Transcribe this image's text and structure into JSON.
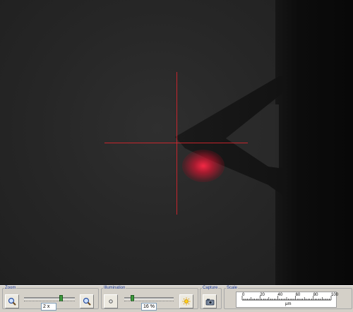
{
  "controls": {
    "zoom": {
      "legend": "Zoom",
      "value_text": "2 x",
      "slider_level_pct": 72
    },
    "illumination": {
      "legend": "Illumination",
      "value_text": "16 %",
      "slider_level_pct": 16
    },
    "capture": {
      "legend": "Capture"
    },
    "scale": {
      "legend": "Scale",
      "ticks": [
        "0",
        "20",
        "40",
        "60",
        "80",
        "100"
      ],
      "unit": "µm"
    }
  },
  "icons": {
    "zoom_out": "zoom-out-icon",
    "zoom_in": "zoom-in-icon",
    "dim": "light-dim-icon",
    "bright": "light-bright-icon",
    "capture": "camera-icon"
  },
  "colors": {
    "crosshair": "#e0262e",
    "laser": "#ff2846",
    "legend_text": "#1f3c9a"
  }
}
